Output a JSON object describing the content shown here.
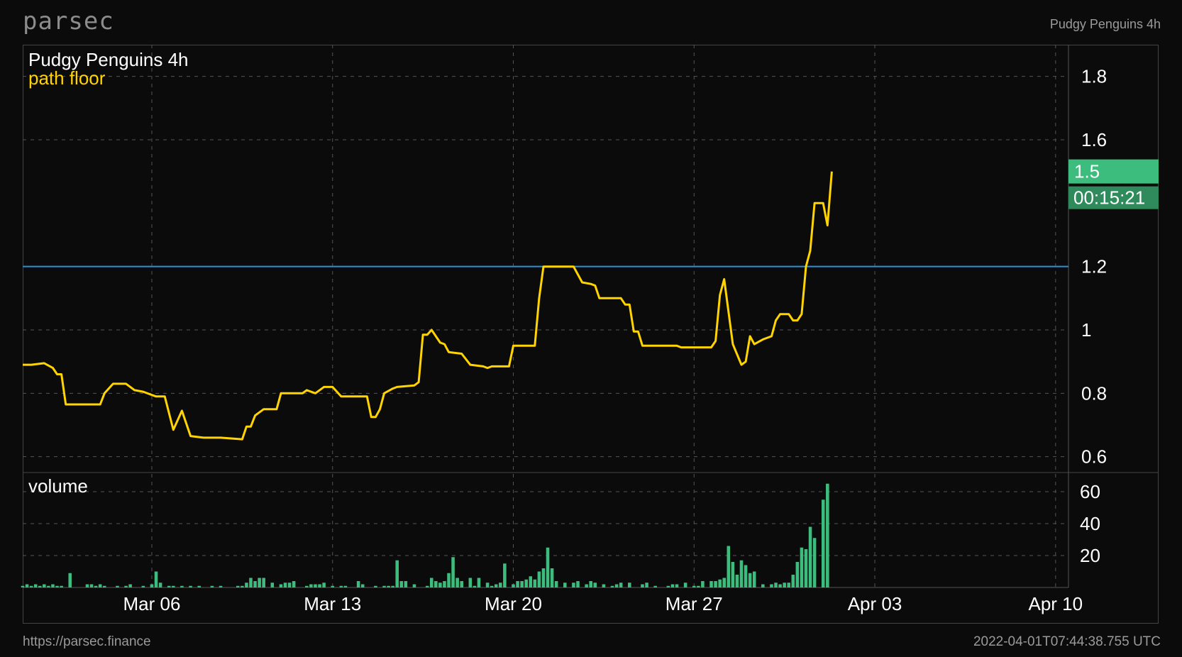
{
  "header": {
    "logo": "parsec",
    "top_right": "Pudgy Penguins 4h"
  },
  "footer": {
    "url": "https://parsec.finance",
    "timestamp": "2022-04-01T07:44:38.755 UTC"
  },
  "colors": {
    "price": "#ffd400",
    "volume": "#3dbd7d",
    "hline": "#2f8fd6",
    "badge": "#3dbd7d",
    "grid": "#555555"
  },
  "chart_data": {
    "type": "line",
    "title": "Pudgy Penguins 4h",
    "series_label": "path floor",
    "volume_label": "volume",
    "x_ticks": [
      "Mar 06",
      "Mar 13",
      "Mar 20",
      "Mar 27",
      "Apr 03",
      "Apr 10"
    ],
    "y_ticks": [
      "0.6",
      "0.8",
      "1",
      "1.2",
      "1.6",
      "1.8"
    ],
    "volume_ticks": [
      "20",
      "40",
      "60"
    ],
    "ylim": [
      0.55,
      1.9
    ],
    "volume_ylim": [
      0,
      72
    ],
    "hline_value": 1.2,
    "last_value": "1.5",
    "countdown": "00:15:21",
    "x_start": "2022-03-01T00:00",
    "x_end": "2022-04-10T12:00",
    "floor": [
      [
        "2022-03-01T00:00",
        0.89
      ],
      [
        "2022-03-01T08:00",
        0.89
      ],
      [
        "2022-03-01T20:00",
        0.895
      ],
      [
        "2022-03-02T04:00",
        0.88
      ],
      [
        "2022-03-02T08:00",
        0.86
      ],
      [
        "2022-03-02T12:00",
        0.86
      ],
      [
        "2022-03-02T16:00",
        0.765
      ],
      [
        "2022-03-03T00:00",
        0.765
      ],
      [
        "2022-03-04T00:00",
        0.765
      ],
      [
        "2022-03-04T04:00",
        0.8
      ],
      [
        "2022-03-04T12:00",
        0.83
      ],
      [
        "2022-03-05T00:00",
        0.83
      ],
      [
        "2022-03-05T08:00",
        0.81
      ],
      [
        "2022-03-05T16:00",
        0.805
      ],
      [
        "2022-03-06T00:00",
        0.795
      ],
      [
        "2022-03-06T04:00",
        0.79
      ],
      [
        "2022-03-06T12:00",
        0.79
      ],
      [
        "2022-03-06T20:00",
        0.685
      ],
      [
        "2022-03-07T04:00",
        0.745
      ],
      [
        "2022-03-07T12:00",
        0.665
      ],
      [
        "2022-03-08T00:00",
        0.66
      ],
      [
        "2022-03-08T16:00",
        0.66
      ],
      [
        "2022-03-09T12:00",
        0.655
      ],
      [
        "2022-03-09T16:00",
        0.695
      ],
      [
        "2022-03-09T20:00",
        0.695
      ],
      [
        "2022-03-10T00:00",
        0.73
      ],
      [
        "2022-03-10T08:00",
        0.75
      ],
      [
        "2022-03-10T20:00",
        0.75
      ],
      [
        "2022-03-11T00:00",
        0.8
      ],
      [
        "2022-03-11T20:00",
        0.8
      ],
      [
        "2022-03-12T00:00",
        0.81
      ],
      [
        "2022-03-12T08:00",
        0.8
      ],
      [
        "2022-03-12T16:00",
        0.82
      ],
      [
        "2022-03-13T00:00",
        0.82
      ],
      [
        "2022-03-13T08:00",
        0.79
      ],
      [
        "2022-03-14T08:00",
        0.79
      ],
      [
        "2022-03-14T12:00",
        0.725
      ],
      [
        "2022-03-14T16:00",
        0.725
      ],
      [
        "2022-03-14T20:00",
        0.75
      ],
      [
        "2022-03-15T00:00",
        0.8
      ],
      [
        "2022-03-15T08:00",
        0.815
      ],
      [
        "2022-03-15T12:00",
        0.82
      ],
      [
        "2022-03-16T04:00",
        0.825
      ],
      [
        "2022-03-16T08:00",
        0.835
      ],
      [
        "2022-03-16T12:00",
        0.985
      ],
      [
        "2022-03-16T16:00",
        0.985
      ],
      [
        "2022-03-16T20:00",
        1.0
      ],
      [
        "2022-03-17T04:00",
        0.96
      ],
      [
        "2022-03-17T08:00",
        0.955
      ],
      [
        "2022-03-17T12:00",
        0.93
      ],
      [
        "2022-03-18T00:00",
        0.925
      ],
      [
        "2022-03-18T08:00",
        0.89
      ],
      [
        "2022-03-18T20:00",
        0.885
      ],
      [
        "2022-03-19T00:00",
        0.88
      ],
      [
        "2022-03-19T04:00",
        0.885
      ],
      [
        "2022-03-19T20:00",
        0.885
      ],
      [
        "2022-03-20T00:00",
        0.95
      ],
      [
        "2022-03-20T20:00",
        0.95
      ],
      [
        "2022-03-21T00:00",
        1.1
      ],
      [
        "2022-03-21T04:00",
        1.2
      ],
      [
        "2022-03-22T08:00",
        1.2
      ],
      [
        "2022-03-22T16:00",
        1.15
      ],
      [
        "2022-03-23T00:00",
        1.145
      ],
      [
        "2022-03-23T04:00",
        1.14
      ],
      [
        "2022-03-23T08:00",
        1.1
      ],
      [
        "2022-03-24T04:00",
        1.1
      ],
      [
        "2022-03-24T08:00",
        1.08
      ],
      [
        "2022-03-24T12:00",
        1.08
      ],
      [
        "2022-03-24T16:00",
        0.995
      ],
      [
        "2022-03-24T20:00",
        0.995
      ],
      [
        "2022-03-25T00:00",
        0.95
      ],
      [
        "2022-03-26T08:00",
        0.95
      ],
      [
        "2022-03-26T12:00",
        0.945
      ],
      [
        "2022-03-27T16:00",
        0.945
      ],
      [
        "2022-03-27T20:00",
        0.965
      ],
      [
        "2022-03-28T00:00",
        1.11
      ],
      [
        "2022-03-28T04:00",
        1.16
      ],
      [
        "2022-03-28T12:00",
        0.955
      ],
      [
        "2022-03-28T20:00",
        0.89
      ],
      [
        "2022-03-29T00:00",
        0.9
      ],
      [
        "2022-03-29T04:00",
        0.98
      ],
      [
        "2022-03-29T08:00",
        0.955
      ],
      [
        "2022-03-29T16:00",
        0.97
      ],
      [
        "2022-03-30T00:00",
        0.98
      ],
      [
        "2022-03-30T04:00",
        1.03
      ],
      [
        "2022-03-30T08:00",
        1.05
      ],
      [
        "2022-03-30T16:00",
        1.05
      ],
      [
        "2022-03-30T20:00",
        1.03
      ],
      [
        "2022-03-31T00:00",
        1.03
      ],
      [
        "2022-03-31T04:00",
        1.05
      ],
      [
        "2022-03-31T08:00",
        1.2
      ],
      [
        "2022-03-31T12:00",
        1.25
      ],
      [
        "2022-03-31T16:00",
        1.4
      ],
      [
        "2022-03-31T20:00",
        1.4
      ],
      [
        "2022-04-01T00:00",
        1.4
      ],
      [
        "2022-04-01T04:00",
        1.33
      ],
      [
        "2022-04-01T08:00",
        1.5
      ]
    ],
    "volume": [
      [
        "2022-03-01T00:00",
        1
      ],
      [
        "2022-03-01T04:00",
        2
      ],
      [
        "2022-03-01T08:00",
        1
      ],
      [
        "2022-03-01T12:00",
        2
      ],
      [
        "2022-03-01T16:00",
        1
      ],
      [
        "2022-03-01T20:00",
        2
      ],
      [
        "2022-03-02T00:00",
        1
      ],
      [
        "2022-03-02T04:00",
        2
      ],
      [
        "2022-03-02T08:00",
        1
      ],
      [
        "2022-03-02T12:00",
        1
      ],
      [
        "2022-03-02T20:00",
        9
      ],
      [
        "2022-03-03T12:00",
        2
      ],
      [
        "2022-03-03T16:00",
        2
      ],
      [
        "2022-03-03T20:00",
        1
      ],
      [
        "2022-03-04T00:00",
        2
      ],
      [
        "2022-03-04T04:00",
        1
      ],
      [
        "2022-03-04T16:00",
        1
      ],
      [
        "2022-03-05T00:00",
        1
      ],
      [
        "2022-03-05T04:00",
        2
      ],
      [
        "2022-03-05T16:00",
        1
      ],
      [
        "2022-03-06T00:00",
        2
      ],
      [
        "2022-03-06T04:00",
        10
      ],
      [
        "2022-03-06T08:00",
        3
      ],
      [
        "2022-03-06T16:00",
        1
      ],
      [
        "2022-03-06T20:00",
        1
      ],
      [
        "2022-03-07T04:00",
        1
      ],
      [
        "2022-03-07T12:00",
        1
      ],
      [
        "2022-03-07T20:00",
        1
      ],
      [
        "2022-03-08T08:00",
        1
      ],
      [
        "2022-03-08T16:00",
        1
      ],
      [
        "2022-03-09T08:00",
        1
      ],
      [
        "2022-03-09T12:00",
        1
      ],
      [
        "2022-03-09T16:00",
        3
      ],
      [
        "2022-03-09T20:00",
        6
      ],
      [
        "2022-03-10T00:00",
        4
      ],
      [
        "2022-03-10T04:00",
        6
      ],
      [
        "2022-03-10T08:00",
        6
      ],
      [
        "2022-03-10T16:00",
        3
      ],
      [
        "2022-03-11T00:00",
        2
      ],
      [
        "2022-03-11T04:00",
        3
      ],
      [
        "2022-03-11T08:00",
        3
      ],
      [
        "2022-03-11T12:00",
        4
      ],
      [
        "2022-03-12T00:00",
        1
      ],
      [
        "2022-03-12T04:00",
        2
      ],
      [
        "2022-03-12T08:00",
        2
      ],
      [
        "2022-03-12T12:00",
        2
      ],
      [
        "2022-03-12T16:00",
        3
      ],
      [
        "2022-03-13T00:00",
        1
      ],
      [
        "2022-03-13T08:00",
        1
      ],
      [
        "2022-03-13T12:00",
        1
      ],
      [
        "2022-03-14T00:00",
        4
      ],
      [
        "2022-03-14T04:00",
        2
      ],
      [
        "2022-03-14T16:00",
        1
      ],
      [
        "2022-03-15T00:00",
        1
      ],
      [
        "2022-03-15T04:00",
        1
      ],
      [
        "2022-03-15T08:00",
        1
      ],
      [
        "2022-03-15T12:00",
        17
      ],
      [
        "2022-03-15T16:00",
        4
      ],
      [
        "2022-03-15T20:00",
        4
      ],
      [
        "2022-03-16T04:00",
        2
      ],
      [
        "2022-03-16T16:00",
        1
      ],
      [
        "2022-03-16T20:00",
        6
      ],
      [
        "2022-03-17T00:00",
        4
      ],
      [
        "2022-03-17T04:00",
        3
      ],
      [
        "2022-03-17T08:00",
        4
      ],
      [
        "2022-03-17T12:00",
        9
      ],
      [
        "2022-03-17T16:00",
        19
      ],
      [
        "2022-03-17T20:00",
        6
      ],
      [
        "2022-03-18T00:00",
        4
      ],
      [
        "2022-03-18T08:00",
        6
      ],
      [
        "2022-03-18T12:00",
        1
      ],
      [
        "2022-03-18T16:00",
        6
      ],
      [
        "2022-03-19T00:00",
        3
      ],
      [
        "2022-03-19T04:00",
        1
      ],
      [
        "2022-03-19T08:00",
        2
      ],
      [
        "2022-03-19T12:00",
        3
      ],
      [
        "2022-03-19T16:00",
        15
      ],
      [
        "2022-03-20T00:00",
        2
      ],
      [
        "2022-03-20T04:00",
        4
      ],
      [
        "2022-03-20T08:00",
        4
      ],
      [
        "2022-03-20T12:00",
        5
      ],
      [
        "2022-03-20T16:00",
        7
      ],
      [
        "2022-03-20T20:00",
        5
      ],
      [
        "2022-03-21T00:00",
        10
      ],
      [
        "2022-03-21T04:00",
        12
      ],
      [
        "2022-03-21T08:00",
        25
      ],
      [
        "2022-03-21T12:00",
        12
      ],
      [
        "2022-03-21T16:00",
        4
      ],
      [
        "2022-03-22T00:00",
        3
      ],
      [
        "2022-03-22T08:00",
        3
      ],
      [
        "2022-03-22T12:00",
        4
      ],
      [
        "2022-03-22T20:00",
        2
      ],
      [
        "2022-03-23T00:00",
        4
      ],
      [
        "2022-03-23T04:00",
        3
      ],
      [
        "2022-03-23T12:00",
        2
      ],
      [
        "2022-03-23T20:00",
        1
      ],
      [
        "2022-03-24T00:00",
        2
      ],
      [
        "2022-03-24T04:00",
        3
      ],
      [
        "2022-03-24T12:00",
        3
      ],
      [
        "2022-03-25T00:00",
        2
      ],
      [
        "2022-03-25T04:00",
        3
      ],
      [
        "2022-03-25T12:00",
        1
      ],
      [
        "2022-03-26T00:00",
        1
      ],
      [
        "2022-03-26T04:00",
        2
      ],
      [
        "2022-03-26T08:00",
        2
      ],
      [
        "2022-03-26T16:00",
        3
      ],
      [
        "2022-03-27T00:00",
        1
      ],
      [
        "2022-03-27T04:00",
        1
      ],
      [
        "2022-03-27T08:00",
        4
      ],
      [
        "2022-03-27T16:00",
        4
      ],
      [
        "2022-03-27T20:00",
        4
      ],
      [
        "2022-03-28T00:00",
        5
      ],
      [
        "2022-03-28T04:00",
        6
      ],
      [
        "2022-03-28T08:00",
        26
      ],
      [
        "2022-03-28T12:00",
        16
      ],
      [
        "2022-03-28T16:00",
        8
      ],
      [
        "2022-03-28T20:00",
        17
      ],
      [
        "2022-03-29T00:00",
        14
      ],
      [
        "2022-03-29T04:00",
        9
      ],
      [
        "2022-03-29T08:00",
        10
      ],
      [
        "2022-03-29T16:00",
        2
      ],
      [
        "2022-03-30T00:00",
        2
      ],
      [
        "2022-03-30T04:00",
        3
      ],
      [
        "2022-03-30T08:00",
        2
      ],
      [
        "2022-03-30T12:00",
        3
      ],
      [
        "2022-03-30T16:00",
        3
      ],
      [
        "2022-03-30T20:00",
        8
      ],
      [
        "2022-03-31T00:00",
        16
      ],
      [
        "2022-03-31T04:00",
        25
      ],
      [
        "2022-03-31T08:00",
        24
      ],
      [
        "2022-03-31T12:00",
        38
      ],
      [
        "2022-03-31T16:00",
        31
      ],
      [
        "2022-04-01T00:00",
        55
      ],
      [
        "2022-04-01T04:00",
        65
      ]
    ]
  }
}
